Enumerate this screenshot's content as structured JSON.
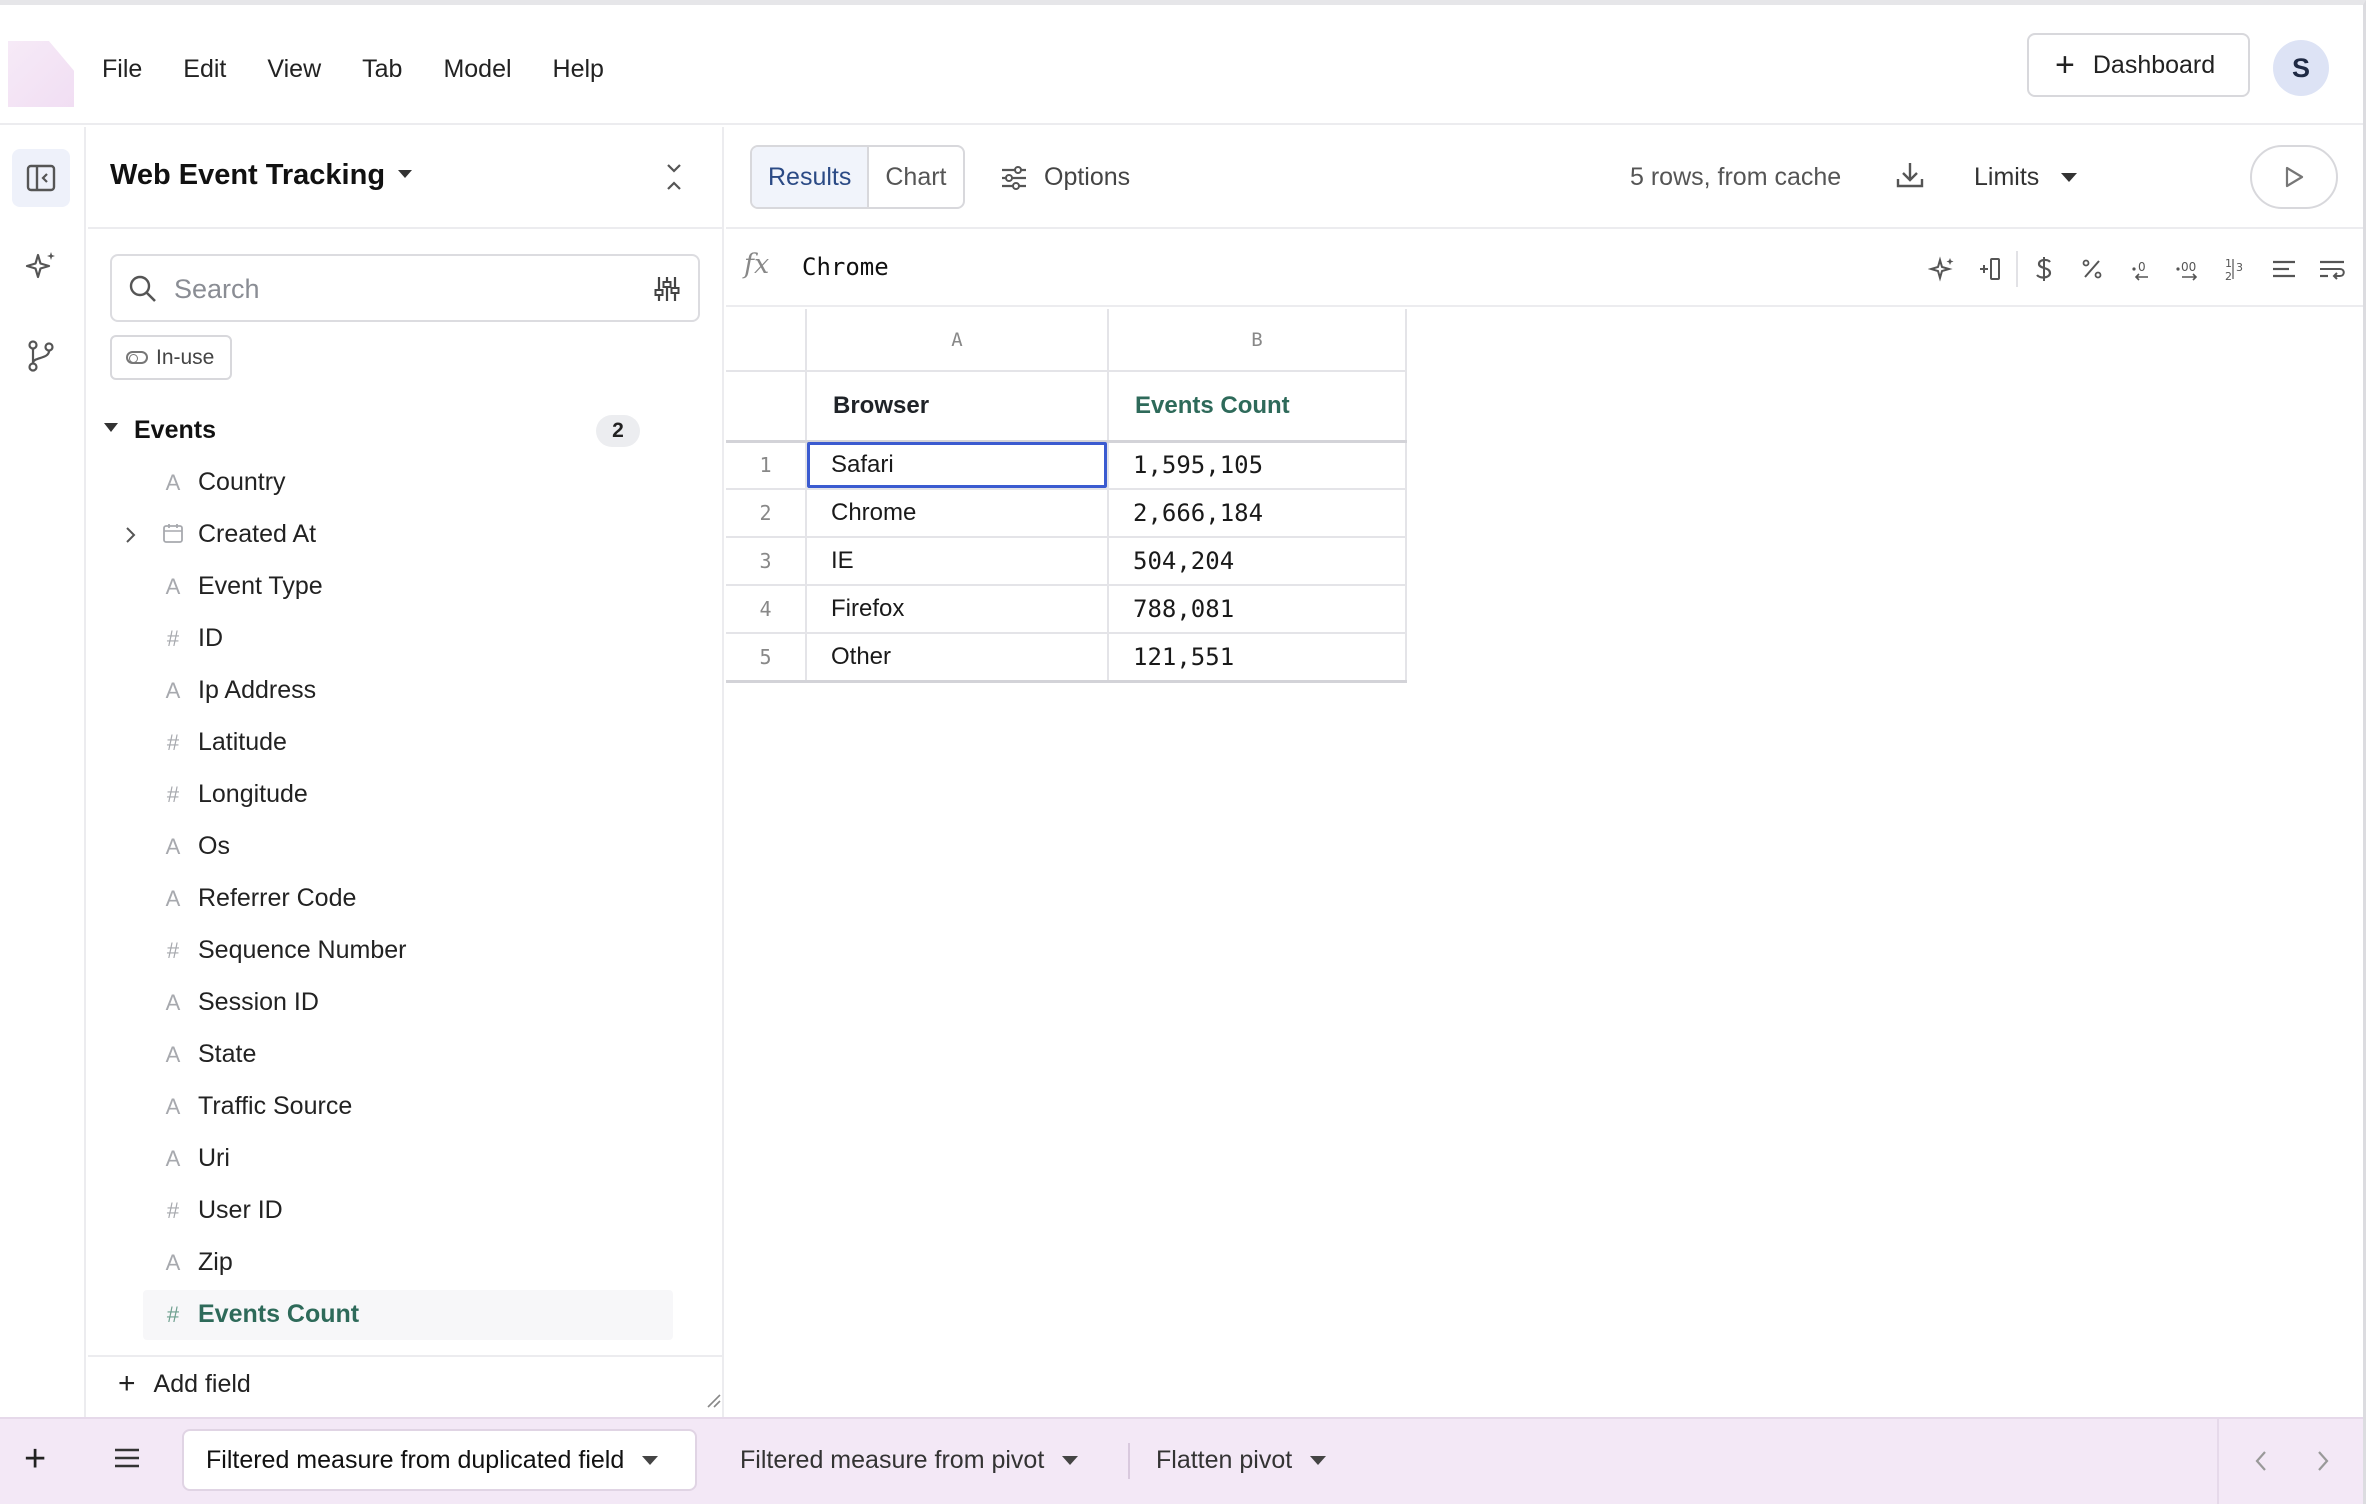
{
  "menu": [
    "File",
    "Edit",
    "View",
    "Tab",
    "Model",
    "Help"
  ],
  "header": {
    "dashboard_label": "Dashboard",
    "avatar_initial": "S"
  },
  "sidebar": {
    "title": "Web Event Tracking",
    "search_placeholder": "Search",
    "inuse_label": "In-use",
    "group": {
      "name": "Events",
      "count": "2"
    },
    "fields": [
      {
        "name": "Country",
        "type": "string"
      },
      {
        "name": "Created At",
        "type": "date",
        "expandable": true
      },
      {
        "name": "Event Type",
        "type": "string"
      },
      {
        "name": "ID",
        "type": "number"
      },
      {
        "name": "Ip Address",
        "type": "string"
      },
      {
        "name": "Latitude",
        "type": "number"
      },
      {
        "name": "Longitude",
        "type": "number"
      },
      {
        "name": "Os",
        "type": "string"
      },
      {
        "name": "Referrer Code",
        "type": "string"
      },
      {
        "name": "Sequence Number",
        "type": "number"
      },
      {
        "name": "Session ID",
        "type": "string"
      },
      {
        "name": "State",
        "type": "string"
      },
      {
        "name": "Traffic Source",
        "type": "string"
      },
      {
        "name": "Uri",
        "type": "string"
      },
      {
        "name": "User ID",
        "type": "number"
      },
      {
        "name": "Zip",
        "type": "string"
      },
      {
        "name": "Events Count",
        "type": "number",
        "active": true
      }
    ],
    "add_field_label": "Add field"
  },
  "toolbar": {
    "results_label": "Results",
    "chart_label": "Chart",
    "options_label": "Options",
    "row_info": "5 rows, from cache",
    "limits_label": "Limits"
  },
  "formula": {
    "icon": "fx",
    "value": "Chrome"
  },
  "grid": {
    "column_letters": [
      "A",
      "B"
    ],
    "headers": [
      "Browser",
      "Events Count"
    ],
    "rows": [
      {
        "n": "1",
        "browser": "Safari",
        "count": "1,595,105"
      },
      {
        "n": "2",
        "browser": "Chrome",
        "count": "2,666,184"
      },
      {
        "n": "3",
        "browser": "IE",
        "count": "504,204"
      },
      {
        "n": "4",
        "browser": "Firefox",
        "count": "788,081"
      },
      {
        "n": "5",
        "browser": "Other",
        "count": "121,551"
      }
    ]
  },
  "bottom_tabs": [
    {
      "label": "Filtered measure from duplicated field",
      "active": true
    },
    {
      "label": "Filtered measure from pivot",
      "active": false
    },
    {
      "label": "Flatten pivot",
      "active": false
    }
  ],
  "colors": {
    "accent": "#3b5bd0",
    "measure": "#2e6a5a",
    "tabbar": "#f3e8f6"
  }
}
